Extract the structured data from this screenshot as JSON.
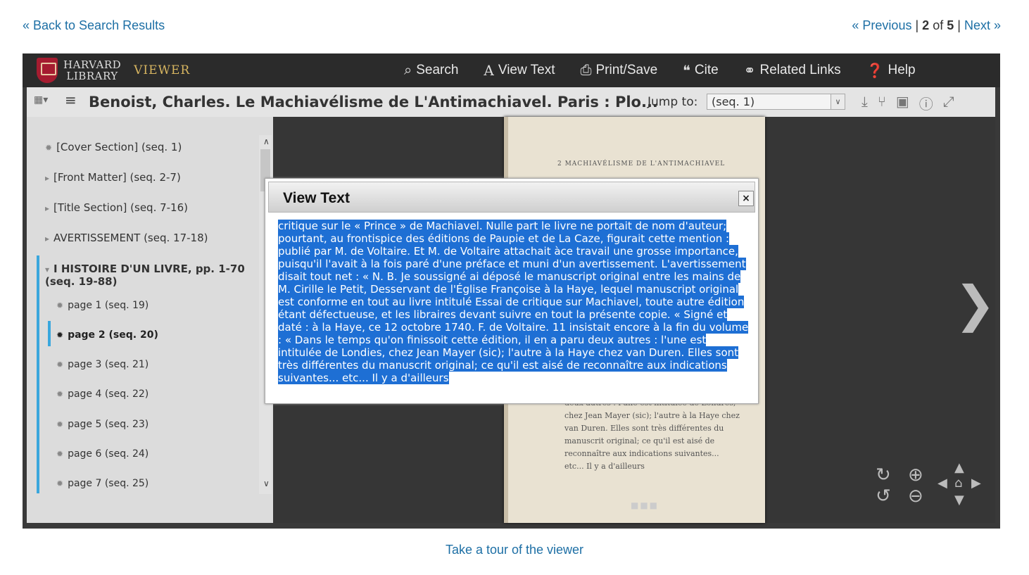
{
  "nav": {
    "back": "« Back to Search Results",
    "previous": "« Previous",
    "sep1": "|",
    "current": "2",
    "of_text": "of",
    "total": "5",
    "sep2": "|",
    "next": "Next »"
  },
  "header": {
    "logo_line1": "HARVARD",
    "logo_line2": "LIBRARY",
    "logo_viewer": "VIEWER",
    "menu": {
      "search": "Search",
      "view_text": "View Text",
      "print_save": "Print/Save",
      "cite": "Cite",
      "related": "Related Links",
      "help": "Help"
    }
  },
  "toolbar": {
    "title": "Benoist, Charles. Le Machiavélisme de L'Antimachiavel. Paris : Plo...",
    "jump_label": "Jump to:",
    "jump_value": "(seq. 1)"
  },
  "sidebar": {
    "items": [
      {
        "label": "[Cover Section] (seq. 1)"
      },
      {
        "label": "[Front Matter] (seq. 2-7)"
      },
      {
        "label": "[Title Section] (seq. 7-16)"
      },
      {
        "label": "AVERTISSEMENT (seq. 17-18)"
      },
      {
        "label": "I HISTOIRE D'UN LIVRE, pp. 1-70",
        "label2": "(seq. 19-88)"
      },
      {
        "label": "page 1 (seq. 19)"
      },
      {
        "label": "page 2 (seq. 20)"
      },
      {
        "label": "page 3 (seq. 21)"
      },
      {
        "label": "page 4 (seq. 22)"
      },
      {
        "label": "page 5 (seq. 23)"
      },
      {
        "label": "page 6 (seq. 24)"
      },
      {
        "label": "page 7 (seq. 25)"
      }
    ]
  },
  "page": {
    "header": "2  MACHIAVÉLISME DE L'ANTIMACHIAVEL",
    "bottom_text": "deux autres : l'une est intitulée de Londres, chez Jean Mayer (sic); l'autre à la Haye chez van Duren. Elles sont très différentes du manuscrit original; ce qu'il est aisé de reconnaître aux indications suivantes... etc... Il y a d'ailleurs"
  },
  "modal": {
    "title": "View Text",
    "close": "×",
    "body": "critique sur le « Prince » de Machiavel. Nulle part le livre ne portait de nom d'auteur; pourtant, au frontispice des éditions de Paupie et de La Caze, figurait cette mention : publié par M. de Voltaire. Et M. de Voltaire attachait àce travail une grosse importance, puisqu'il l'avait à la fois paré d'une préface et muni d'un avertissement. L'avertissement disait tout net : « N. B. Je soussigné ai déposé le manuscript original entre les mains de M. Cirille le Petit, Desservant de l'Église Françoise à la Haye, lequel manuscript original est conforme en tout au livre intitulé Essai de critique sur Machiavel, toute autre édition étant défectueuse, et les libraires devant suivre en tout la présente copie. « Signé et daté : à la Haye, ce 12 octobre 1740. F. de Voltaire. 11 insistait encore à la fin du volume : « Dans le temps qu'on finissoit cette édition, il en a paru deux autres : l'une est intitulée de Londies, chez Jean Mayer (sic); l'autre à la Haye chez van Duren. Elles sont très différentes du manuscrit original; ce qu'il est aisé de reconnaître aux indications suivantes... etc... Il y a d'ailleurs"
  },
  "footer": {
    "tour": "Take a tour of the viewer"
  }
}
